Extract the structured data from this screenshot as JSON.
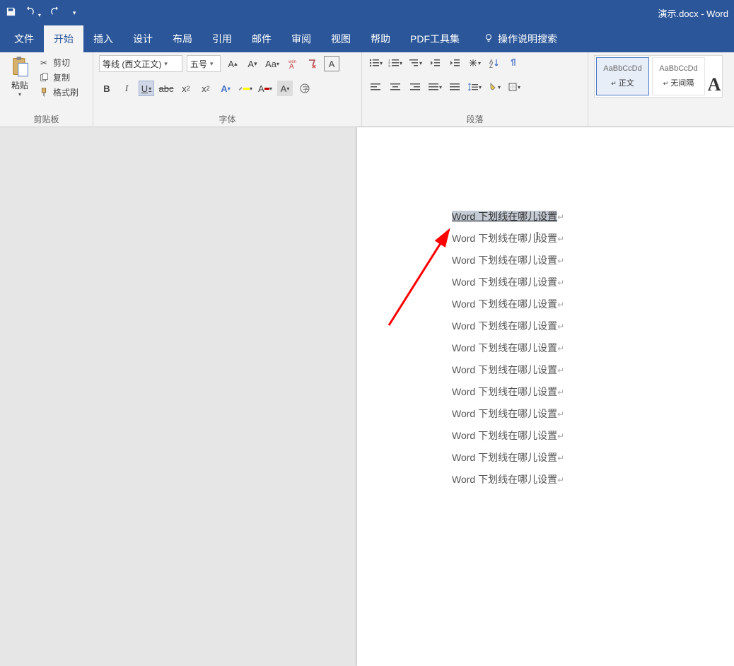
{
  "title": "演示.docx - Word",
  "tabs": {
    "file": "文件",
    "home": "开始",
    "insert": "插入",
    "design": "设计",
    "layout": "布局",
    "references": "引用",
    "mailings": "邮件",
    "review": "审阅",
    "view": "视图",
    "help": "帮助",
    "pdf": "PDF工具集",
    "tellme": "操作说明搜索"
  },
  "clipboard": {
    "paste": "粘贴",
    "cut": "剪切",
    "copy": "复制",
    "formatpainter": "格式刷",
    "label": "剪贴板"
  },
  "font": {
    "name": "等线 (西文正文)",
    "size": "五号",
    "label": "字体"
  },
  "paragraph": {
    "label": "段落"
  },
  "styles": {
    "preview": "AaBbCcDd",
    "normal": "正文",
    "nospacing": "无间隔"
  },
  "doc": {
    "text": "Word 下划线在哪儿设置",
    "lines": 13
  }
}
